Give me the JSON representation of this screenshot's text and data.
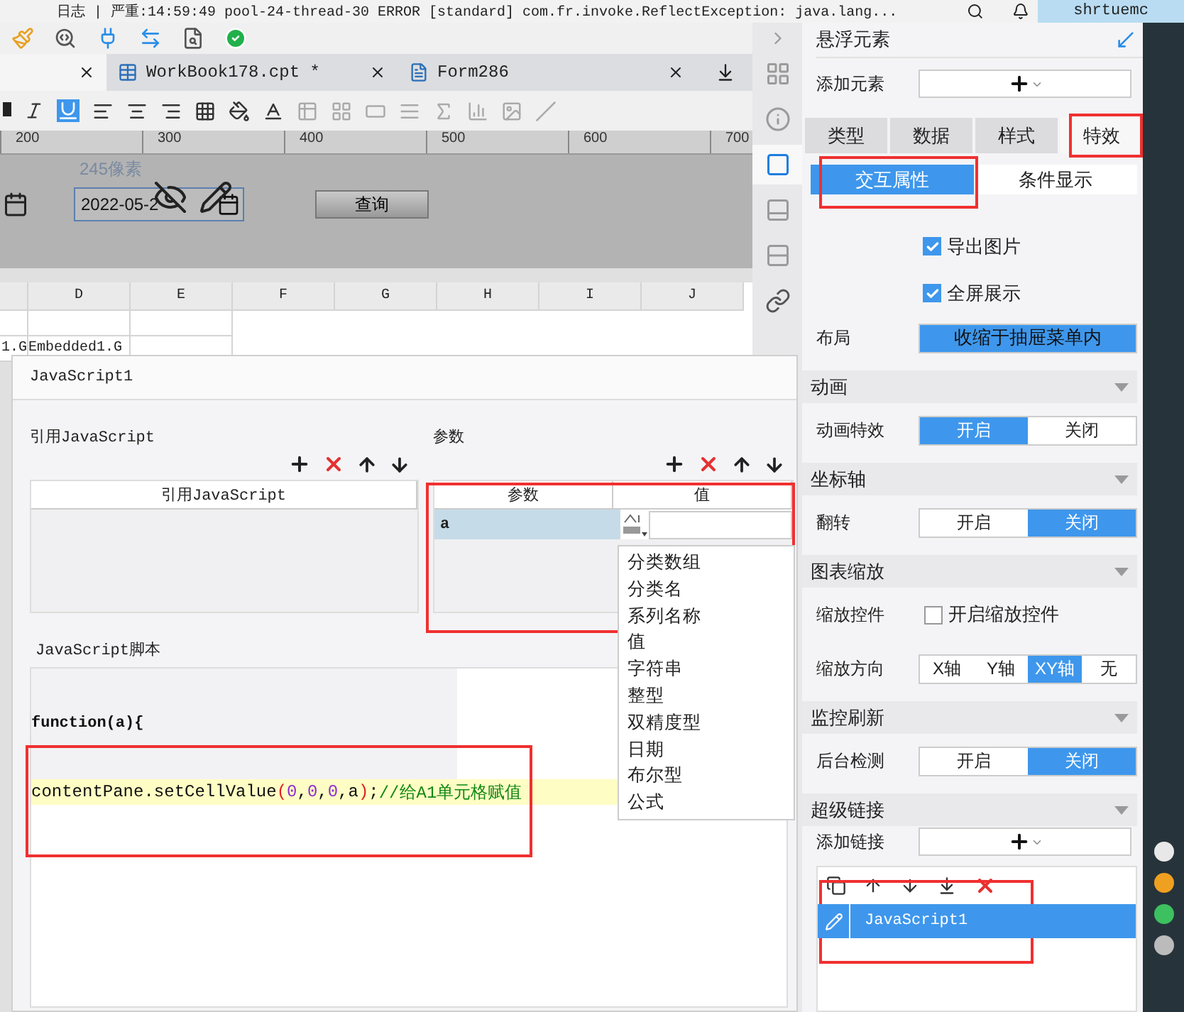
{
  "log_bar": {
    "text": "日志 | 严重:14:59:49 pool-24-thread-30 ERROR [standard] com.fr.invoke.ReflectException: java.lang...",
    "user": "shrtuemc"
  },
  "tabs": [
    {
      "selected": true
    },
    {
      "label": "WorkBook178.cpt *",
      "kind": "report",
      "selected": false
    },
    {
      "label": "Form286",
      "kind": "form",
      "selected": false
    }
  ],
  "ruler": [
    "200",
    "300",
    "400",
    "500",
    "600",
    "700"
  ],
  "canvas": {
    "size_label": "245像素",
    "date_value": "2022-05-2",
    "query_button": "查询"
  },
  "sheet": {
    "columns": [
      "",
      "D",
      "E",
      "F",
      "G",
      "H",
      "I",
      "J"
    ],
    "rows": [
      [
        "1.G",
        "Embedded1.G"
      ]
    ]
  },
  "dialog": {
    "title": "JavaScript1",
    "ref_section": "引用JavaScript",
    "ref_column": "引用JavaScript",
    "params_section": "参数",
    "param_columns": [
      "参数",
      "值"
    ],
    "params": [
      {
        "name": "a",
        "selected": true
      }
    ],
    "type_menu": [
      "分类数组",
      "分类名",
      "系列名称",
      "值",
      "字符串",
      "整型",
      "双精度型",
      "日期",
      "布尔型",
      "公式"
    ],
    "script_section": "JavaScript脚本",
    "script_lines": [
      {
        "kind": "plain",
        "segments": [
          {
            "text": "function(a){",
            "kind": "plain"
          }
        ]
      },
      {
        "kind": "current",
        "segments": [
          {
            "text": "contentPane.setCellValue",
            "kind": "plain"
          },
          {
            "text": "(",
            "kind": "paren"
          },
          {
            "text": "0",
            "kind": "number"
          },
          {
            "text": ",",
            "kind": "plain"
          },
          {
            "text": "0",
            "kind": "number"
          },
          {
            "text": ",",
            "kind": "plain"
          },
          {
            "text": "0",
            "kind": "number"
          },
          {
            "text": ",a",
            "kind": "plain"
          },
          {
            "text": ")",
            "kind": "paren"
          },
          {
            "text": "; ",
            "kind": "plain"
          },
          {
            "text": "//给A1单元格赋值",
            "kind": "comment"
          }
        ]
      }
    ]
  },
  "panel": {
    "title": "悬浮元素",
    "add_element_label": "添加元素",
    "tabs": [
      {
        "label": "类型",
        "selected": false
      },
      {
        "label": "数据",
        "selected": false
      },
      {
        "label": "样式",
        "selected": false
      },
      {
        "label": "特效",
        "selected": true
      }
    ],
    "subtabs": [
      {
        "label": "交互属性",
        "selected": true
      },
      {
        "label": "条件显示",
        "selected": false
      }
    ],
    "checkboxes": [
      {
        "label": "导出图片",
        "checked": true
      },
      {
        "label": "全屏展示",
        "checked": true
      }
    ],
    "layout": {
      "label": "布局",
      "value": "收缩于抽屉菜单内"
    },
    "sections": [
      {
        "title": "动画",
        "rows": [
          {
            "kind": "toggle",
            "label": "动画特效",
            "options": [
              {
                "label": "开启",
                "selected": true
              },
              {
                "label": "关闭",
                "selected": false
              }
            ]
          }
        ]
      },
      {
        "title": "坐标轴",
        "rows": [
          {
            "kind": "toggle",
            "label": "翻转",
            "options": [
              {
                "label": "开启",
                "selected": false
              },
              {
                "label": "关闭",
                "selected": true
              }
            ]
          }
        ]
      },
      {
        "title": "图表缩放",
        "rows": [
          {
            "kind": "checkbox",
            "label": "缩放控件",
            "text": "开启缩放控件",
            "checked": false
          },
          {
            "kind": "toggle",
            "label": "缩放方向",
            "options": [
              {
                "label": "X轴",
                "selected": false
              },
              {
                "label": "Y轴",
                "selected": false
              },
              {
                "label": "XY轴",
                "selected": true
              },
              {
                "label": "无",
                "selected": false
              }
            ]
          }
        ]
      },
      {
        "title": "监控刷新",
        "rows": [
          {
            "kind": "toggle",
            "label": "后台检测",
            "options": [
              {
                "label": "开启",
                "selected": false
              },
              {
                "label": "关闭",
                "selected": true
              }
            ]
          }
        ]
      },
      {
        "title": "超级链接",
        "rows": [
          {
            "kind": "add",
            "label": "添加链接"
          }
        ]
      }
    ],
    "links": [
      {
        "label": "JavaScript1",
        "selected": true
      }
    ]
  }
}
